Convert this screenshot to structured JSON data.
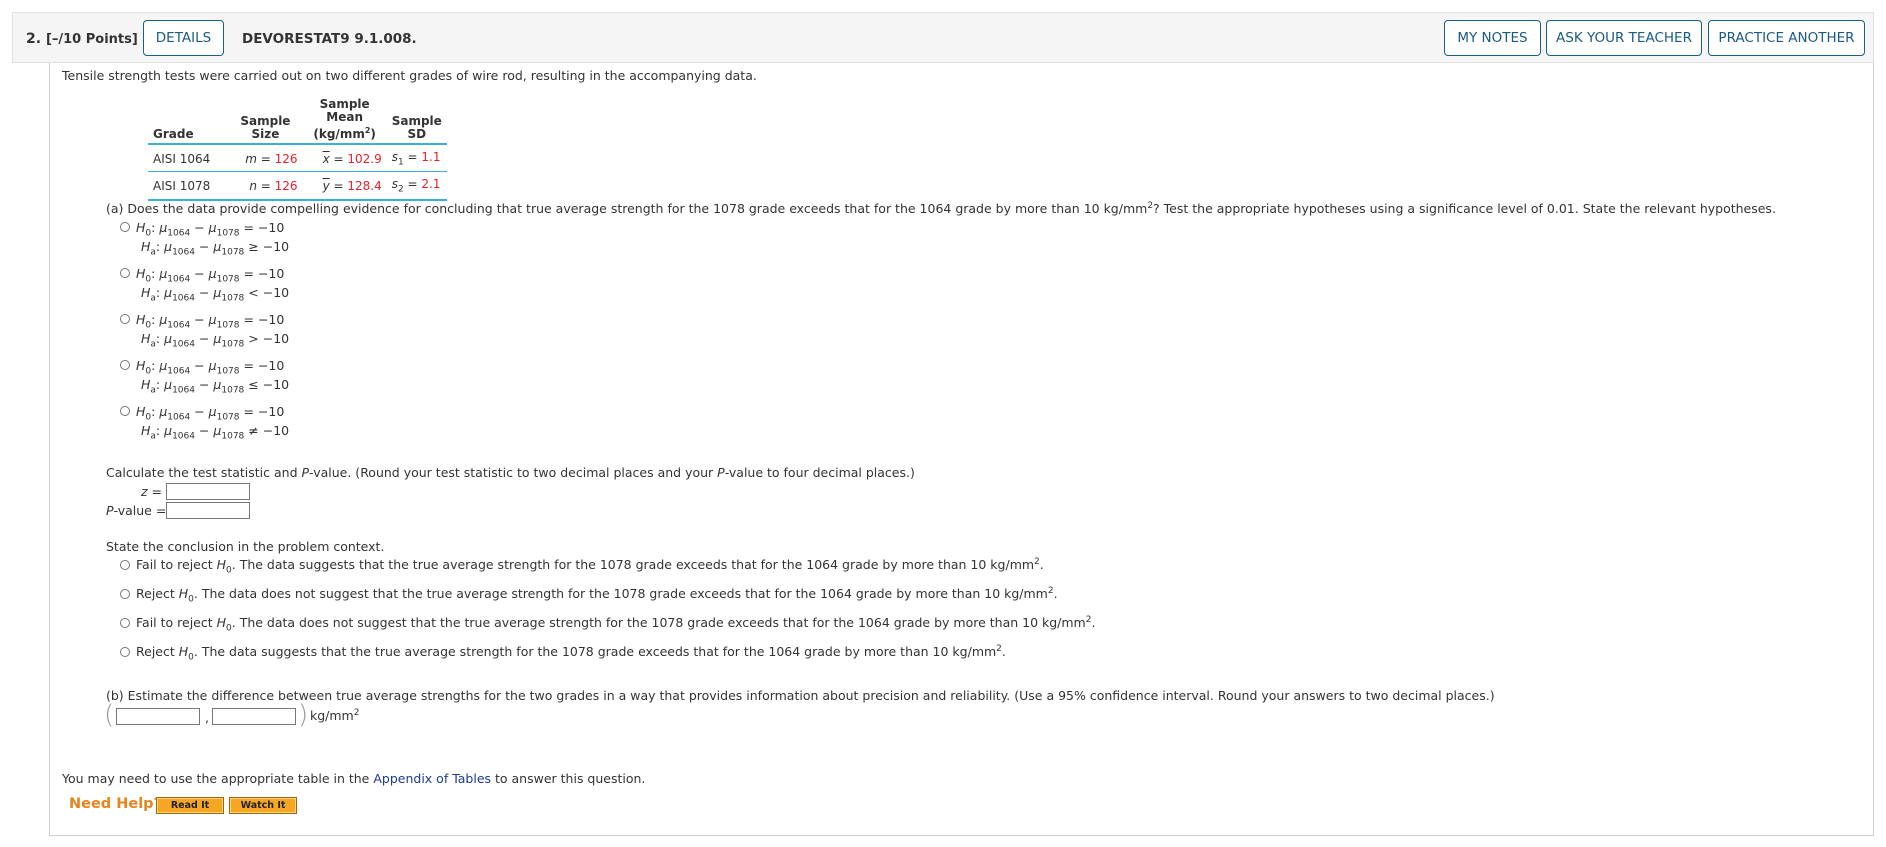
{
  "header": {
    "question_number": "2.",
    "points": "[–/10 Points]",
    "details_label": "DETAILS",
    "question_id": "DEVORESTAT9 9.1.008.",
    "my_notes_label": "MY NOTES",
    "ask_teacher_label": "ASK YOUR TEACHER",
    "practice_label": "PRACTICE ANOTHER",
    "accent_color": "#1a5a86"
  },
  "intro": "Tensile strength tests were carried out on two different grades of wire rod, resulting in the accompanying data.",
  "table": {
    "headers": {
      "grade": "Grade",
      "size_1": "Sample",
      "size_2": "Size",
      "mean_1": "Sample",
      "mean_2": "Mean",
      "mean_3": "(kg/mm",
      "mean_3_sup": "2",
      "mean_3_end": ")",
      "sd_1": "Sample",
      "sd_2": "SD"
    },
    "rows": [
      {
        "grade": "AISI 1064",
        "size_var": "m",
        "size_val": "126",
        "mean_var": "x",
        "mean_val": "102.9",
        "sd_var": "s",
        "sd_sub": "1",
        "sd_val": "1.1"
      },
      {
        "grade": "AISI 1078",
        "size_var": "n",
        "size_val": "126",
        "mean_var": "y",
        "mean_val": "128.4",
        "sd_var": "s",
        "sd_sub": "2",
        "sd_val": "2.1"
      }
    ],
    "line_color": "#3bb0d8",
    "value_color": "#e8202a"
  },
  "part_a": {
    "question": "(a) Does the data provide compelling evidence for concluding that true average strength for the 1078 grade exceeds that for the 1064 grade by more than 10 kg/mm",
    "question_sup": "2",
    "question_end": "? Test the appropriate hypotheses using a significance level of 0.01. State the relevant hypotheses.",
    "h0_symbol": "H",
    "h0_sub": "0",
    "ha_sub": "a",
    "mu": "μ",
    "mu1_sub": "1064",
    "mu2_sub": "1078",
    "minus": "−",
    "null_rel": "=",
    "options": [
      {
        "alt_rel": "≥",
        "value": "−10"
      },
      {
        "alt_rel": "<",
        "value": "−10"
      },
      {
        "alt_rel": ">",
        "value": "−10"
      },
      {
        "alt_rel": "≤",
        "value": "−10"
      },
      {
        "alt_rel": "≠",
        "value": "−10"
      }
    ]
  },
  "calc": {
    "instruction_1": "Calculate the test statistic and ",
    "instruction_p": "P",
    "instruction_2": "-value. (Round your test statistic to two decimal places and your ",
    "instruction_p2": "P",
    "instruction_3": "-value to four decimal places.)",
    "z_label": "z",
    "z_eq": " =",
    "p_label": "P",
    "p_rest": "-value =",
    "z_value": "",
    "p_value": ""
  },
  "conclusion": {
    "prompt": "State the conclusion in the problem context.",
    "options": [
      {
        "decision": "Fail to reject ",
        "text": ". The data suggests that the true average strength for the 1078 grade exceeds that for the 1064 grade by more than 10 kg/mm"
      },
      {
        "decision": "Reject ",
        "text": ". The data does not suggest that the true average strength for the 1078 grade exceeds that for the 1064 grade by more than 10 kg/mm"
      },
      {
        "decision": "Fail to reject ",
        "text": ". The data does not suggest that the true average strength for the 1078 grade exceeds that for the 1064 grade by more than 10 kg/mm"
      },
      {
        "decision": "Reject ",
        "text": ". The data suggests that the true average strength for the 1078 grade exceeds that for the 1064 grade by more than 10 kg/mm"
      }
    ],
    "sup": "2",
    "end": "."
  },
  "part_b": {
    "question": "(b) Estimate the difference between true average strengths for the two grades in a way that provides information about precision and reliability. (Use a 95% confidence interval. Round your answers to two decimal places.)",
    "lower": "",
    "upper": "",
    "unit": "kg/mm",
    "unit_sup": "2",
    "comma": ","
  },
  "footer": {
    "text_1": "You may need to use the appropriate table in the ",
    "link": "Appendix of Tables",
    "text_2": " to answer this question.",
    "need_help": "Need Help?",
    "read_it": "Read It",
    "watch_it": "Watch It",
    "help_color": "#e8841c"
  }
}
